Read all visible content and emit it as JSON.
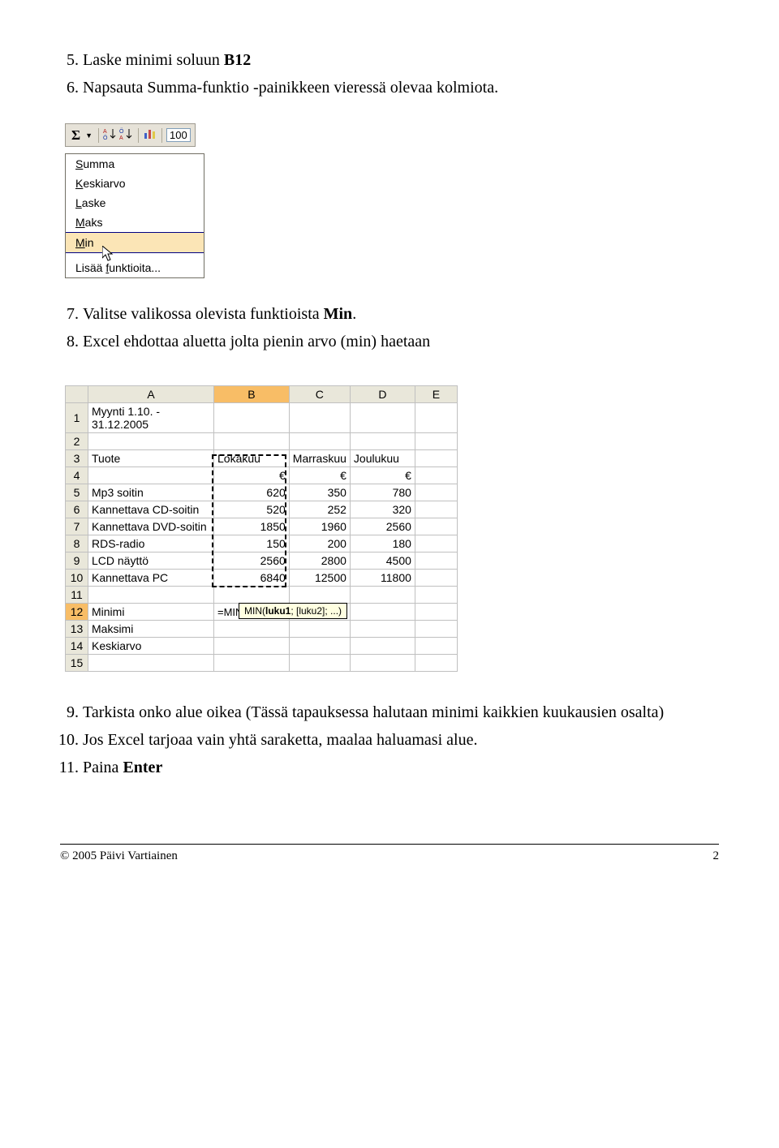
{
  "steps_a": [
    {
      "n": "5.",
      "html": "Laske minimi soluun <b>B12</b>"
    },
    {
      "n": "6.",
      "html": "Napsauta Summa-funktio -painikkeen vieressä olevaa kolmiota."
    }
  ],
  "toolbar_zoom": "100",
  "autosum_menu": {
    "items": [
      {
        "label": "Summa",
        "u": "S",
        "hl": false
      },
      {
        "label": "Keskiarvo",
        "u": "K",
        "hl": false
      },
      {
        "label": "Laske",
        "u": "L",
        "hl": false
      },
      {
        "label": "Maks",
        "u": "M",
        "hl": false
      },
      {
        "label": "Min",
        "u": "M",
        "hl": true
      },
      {
        "label": "Lisää funktioita...",
        "u": "f",
        "hl": false
      }
    ]
  },
  "steps_b": [
    {
      "n": "7.",
      "html": "Valitse valikossa olevista funktioista <b>Min</b>."
    },
    {
      "n": "8.",
      "html": "Excel ehdottaa aluetta jolta pienin arvo (min) haetaan"
    }
  ],
  "chart_data": {
    "type": "table",
    "column_letters": [
      "A",
      "B",
      "C",
      "D",
      "E"
    ],
    "rows": [
      {
        "n": 1,
        "cells": [
          "Myynti 1.10. - 31.12.2005",
          "",
          "",
          "",
          ""
        ]
      },
      {
        "n": 2,
        "cells": [
          "",
          "",
          "",
          "",
          ""
        ]
      },
      {
        "n": 3,
        "cells": [
          "Tuote",
          "Lokakuu",
          "Marraskuu",
          "Joulukuu",
          ""
        ]
      },
      {
        "n": 4,
        "cells": [
          "",
          "€",
          "€",
          "€",
          ""
        ]
      },
      {
        "n": 5,
        "cells": [
          "Mp3 soitin",
          "620",
          "350",
          "780",
          ""
        ]
      },
      {
        "n": 6,
        "cells": [
          "Kannettava CD-soitin",
          "520",
          "252",
          "320",
          ""
        ]
      },
      {
        "n": 7,
        "cells": [
          "Kannettava DVD-soitin",
          "1850",
          "1960",
          "2560",
          ""
        ]
      },
      {
        "n": 8,
        "cells": [
          "RDS-radio",
          "150",
          "200",
          "180",
          ""
        ]
      },
      {
        "n": 9,
        "cells": [
          "LCD näyttö",
          "2560",
          "2800",
          "4500",
          ""
        ]
      },
      {
        "n": 10,
        "cells": [
          "Kannettava PC",
          "6840",
          "12500",
          "11800",
          ""
        ]
      },
      {
        "n": 11,
        "cells": [
          "",
          "",
          "",
          "",
          ""
        ]
      },
      {
        "n": 12,
        "cells": [
          "Minimi",
          "=MIN(B5:B11)",
          "",
          "",
          ""
        ],
        "formula_row": true
      },
      {
        "n": 13,
        "cells": [
          "Maksimi",
          "",
          "",
          "",
          ""
        ]
      },
      {
        "n": 14,
        "cells": [
          "Keskiarvo",
          "",
          "",
          "",
          ""
        ]
      },
      {
        "n": 15,
        "cells": [
          "",
          "",
          "",
          "",
          ""
        ]
      }
    ],
    "tooltip": "MIN(luku1; [luku2]; ...)",
    "selected_row": 12
  },
  "steps_c": [
    {
      "n": "9.",
      "html": "Tarkista onko alue oikea (Tässä tapauksessa halutaan minimi kaikkien kuukausien osalta)"
    },
    {
      "n": "10.",
      "html": "Jos Excel tarjoaa vain yhtä saraketta, maalaa haluamasi alue."
    },
    {
      "n": "11.",
      "html": "Paina <b>Enter</b>"
    }
  ],
  "footer": {
    "left": "© 2005 Päivi Vartiainen",
    "right": "2"
  }
}
